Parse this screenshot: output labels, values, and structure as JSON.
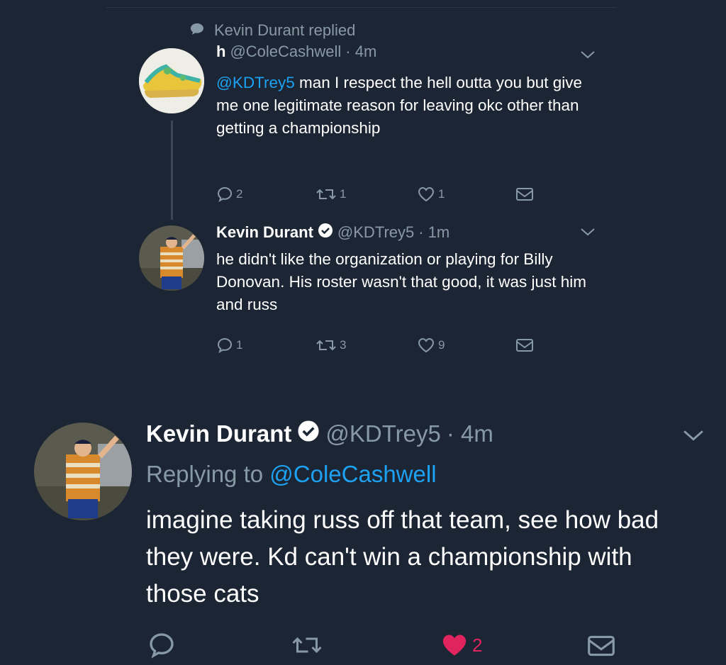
{
  "context": {
    "replied_text": "Kevin Durant replied"
  },
  "tweet1": {
    "display_name": "h",
    "handle": "@ColeCashwell",
    "time": "· 4m",
    "mention": "@KDTrey5",
    "text": " man I respect the hell outta you but give me one legitimate reason for leaving okc other than getting a championship",
    "actions": {
      "reply_count": "2",
      "retweet_count": "1",
      "like_count": "1"
    }
  },
  "tweet2": {
    "display_name": "Kevin Durant",
    "handle": "@KDTrey5",
    "time": "· 1m",
    "text": "he didn't like the organization or playing for Billy Donovan. His roster wasn't that good, it was just him and russ",
    "actions": {
      "reply_count": "1",
      "retweet_count": "3",
      "like_count": "9"
    }
  },
  "tweet3": {
    "display_name": "Kevin Durant",
    "handle": "@KDTrey5",
    "time": "· 4m",
    "replying_prefix": "Replying to ",
    "replying_to": "@ColeCashwell",
    "text": "imagine taking russ off that team, see how bad they were. Kd can't win a championship with those cats",
    "actions": {
      "like_count": "2"
    }
  },
  "colors": {
    "background": "#1c2533",
    "muted": "#8899a6",
    "link": "#1da1f2",
    "liked": "#e0245e"
  },
  "icons": [
    "speech-bubble-icon",
    "chevron-down-icon",
    "verified-badge-icon",
    "reply-icon",
    "retweet-icon",
    "like-icon",
    "message-icon"
  ]
}
